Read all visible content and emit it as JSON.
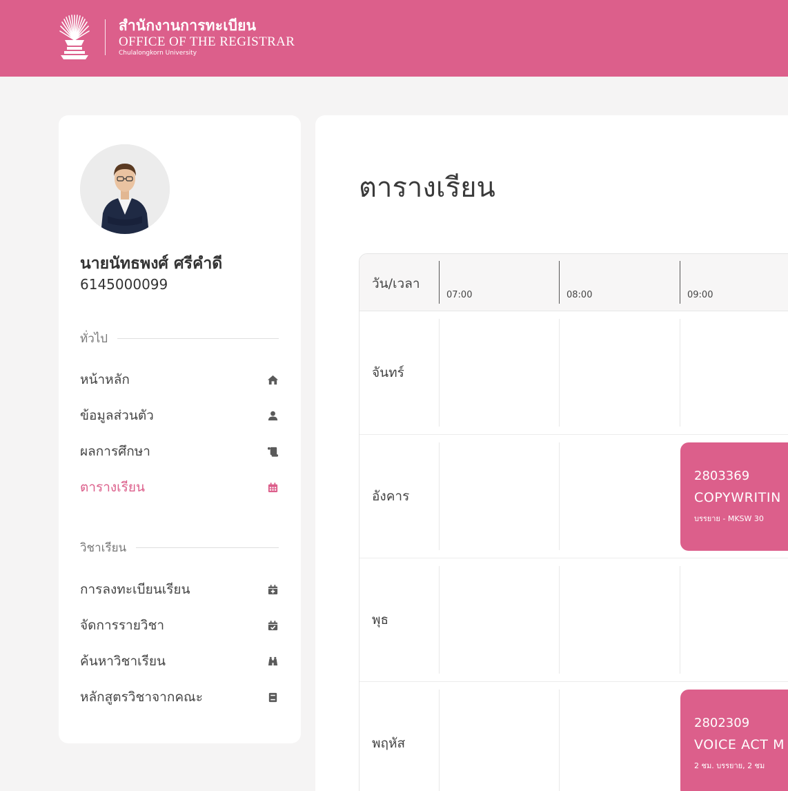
{
  "header": {
    "title_th": "สำนักงานการทะเบียน",
    "title_en": "OFFICE OF THE REGISTRAR",
    "university": "Chulalongkorn University",
    "logo_icon": "chula-phra-kiao-emblem",
    "background_color": "#dc5f8b"
  },
  "profile": {
    "name": "นายนัทธพงศ์ ศรีคำดี",
    "student_id": "6145000099"
  },
  "sidebar": {
    "general_heading": "ทั่วไป",
    "general_items": [
      {
        "label": "หน้าหลัก",
        "icon": "home-icon"
      },
      {
        "label": "ข้อมูลส่วนตัว",
        "icon": "user-icon"
      },
      {
        "label": "ผลการศึกษา",
        "icon": "scroll-icon"
      },
      {
        "label": "ตารางเรียน",
        "icon": "calendar-icon",
        "active": true
      }
    ],
    "course_heading": "วิชาเรียน",
    "course_items": [
      {
        "label": "การลงทะเบียนเรียน",
        "icon": "calendar-plus-icon"
      },
      {
        "label": "จัดการรายวิชา",
        "icon": "calendar-check-icon"
      },
      {
        "label": "ค้นหาวิชาเรียน",
        "icon": "binoculars-icon"
      },
      {
        "label": "หลักสูตรวิชาจากคณะ",
        "icon": "book-icon"
      }
    ]
  },
  "main": {
    "title": "ตารางเรียน",
    "timetable": {
      "corner_label": "วัน/เวลา",
      "hours": [
        "07:00",
        "08:00",
        "09:00"
      ],
      "days": [
        "จันทร์",
        "อังคาร",
        "พุธ",
        "พฤหัส"
      ],
      "courses": [
        {
          "day": "อังคาร",
          "start": "09:00",
          "code": "2803369",
          "name": "COPYWRITIN",
          "info": "บรรยาย - MKSW 30"
        },
        {
          "day": "พฤหัส",
          "start": "09:00",
          "code": "2802309",
          "name": "VOICE ACT M",
          "info": "2 ชม. บรรยาย, 2 ชม"
        }
      ]
    }
  },
  "colors": {
    "accent": "#dc5f8b",
    "page_background": "#f5f4f4",
    "card_background": "#ffffff"
  }
}
